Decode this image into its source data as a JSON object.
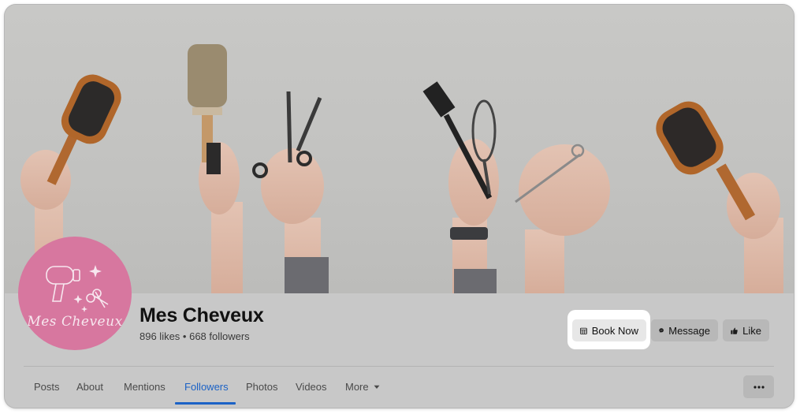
{
  "page": {
    "name": "Mes Cheveux",
    "stats": "896 likes • 668 followers",
    "logo_text": "Mes Cheveux"
  },
  "actions": {
    "book_now": "Book Now",
    "message": "Message",
    "like": "Like"
  },
  "tabs": [
    {
      "label": "Posts"
    },
    {
      "label": "About"
    },
    {
      "label": "Mentions"
    },
    {
      "label": "Followers"
    },
    {
      "label": "Photos"
    },
    {
      "label": "Videos"
    },
    {
      "label": "More"
    }
  ],
  "active_tab": "Followers",
  "colors": {
    "accent": "#1b62c6",
    "avatar_bg": "#d7779f"
  },
  "icons": {
    "book": "calendar-icon",
    "message": "messenger-icon",
    "like": "thumbs-up-icon",
    "more_tab": "caret-down-icon",
    "menu": "ellipsis-icon"
  }
}
